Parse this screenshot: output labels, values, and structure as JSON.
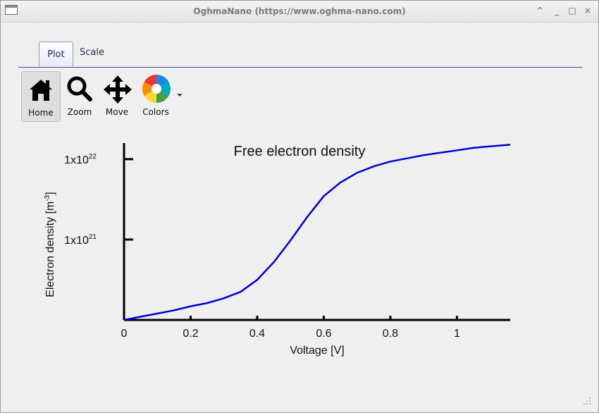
{
  "window": {
    "title": "OghmaNano (https://www.oghma-nano.com)",
    "controls": [
      "^",
      "_",
      "□",
      "×"
    ]
  },
  "tabs": [
    {
      "label": "Plot",
      "active": true
    },
    {
      "label": "Scale",
      "active": false
    }
  ],
  "toolbar": {
    "home_label": "Home",
    "zoom_label": "Zoom",
    "move_label": "Move",
    "colors_label": "Colors"
  },
  "colors": {
    "series": "#0000d0",
    "tab_border": "#3c4aa2"
  },
  "chart_data": {
    "type": "line",
    "title": "Free electron density",
    "xlabel": "Voltage [V]",
    "ylabel_main": "Electron density [m",
    "ylabel_sup": "-3",
    "ylabel_close": "]",
    "xlim": [
      0,
      1.16
    ],
    "ylim_log10": [
      20.0,
      22.2
    ],
    "y_scale": "log",
    "x_ticks": [
      {
        "value": 0,
        "label": "0"
      },
      {
        "value": 0.2,
        "label": "0.2"
      },
      {
        "value": 0.4,
        "label": "0.4"
      },
      {
        "value": 0.6,
        "label": "0.6"
      },
      {
        "value": 0.8,
        "label": "0.8"
      },
      {
        "value": 1.0,
        "label": "1"
      }
    ],
    "y_ticks": [
      {
        "log10": 21,
        "base": "1x10",
        "exp": "21"
      },
      {
        "log10": 22,
        "base": "1x10",
        "exp": "22"
      }
    ],
    "series": [
      {
        "x": [
          0,
          0.05,
          0.1,
          0.15,
          0.2,
          0.25,
          0.3,
          0.35,
          0.4,
          0.45,
          0.5,
          0.55,
          0.6,
          0.65,
          0.7,
          0.75,
          0.8,
          0.85,
          0.9,
          0.95,
          1.0,
          1.05,
          1.1,
          1.16
        ],
        "y_log10": [
          20.0,
          20.04,
          20.08,
          20.12,
          20.17,
          20.21,
          20.27,
          20.35,
          20.5,
          20.72,
          20.99,
          21.28,
          21.54,
          21.71,
          21.83,
          21.91,
          21.97,
          22.01,
          22.05,
          22.08,
          22.11,
          22.14,
          22.16,
          22.18
        ]
      }
    ],
    "grid": false
  }
}
